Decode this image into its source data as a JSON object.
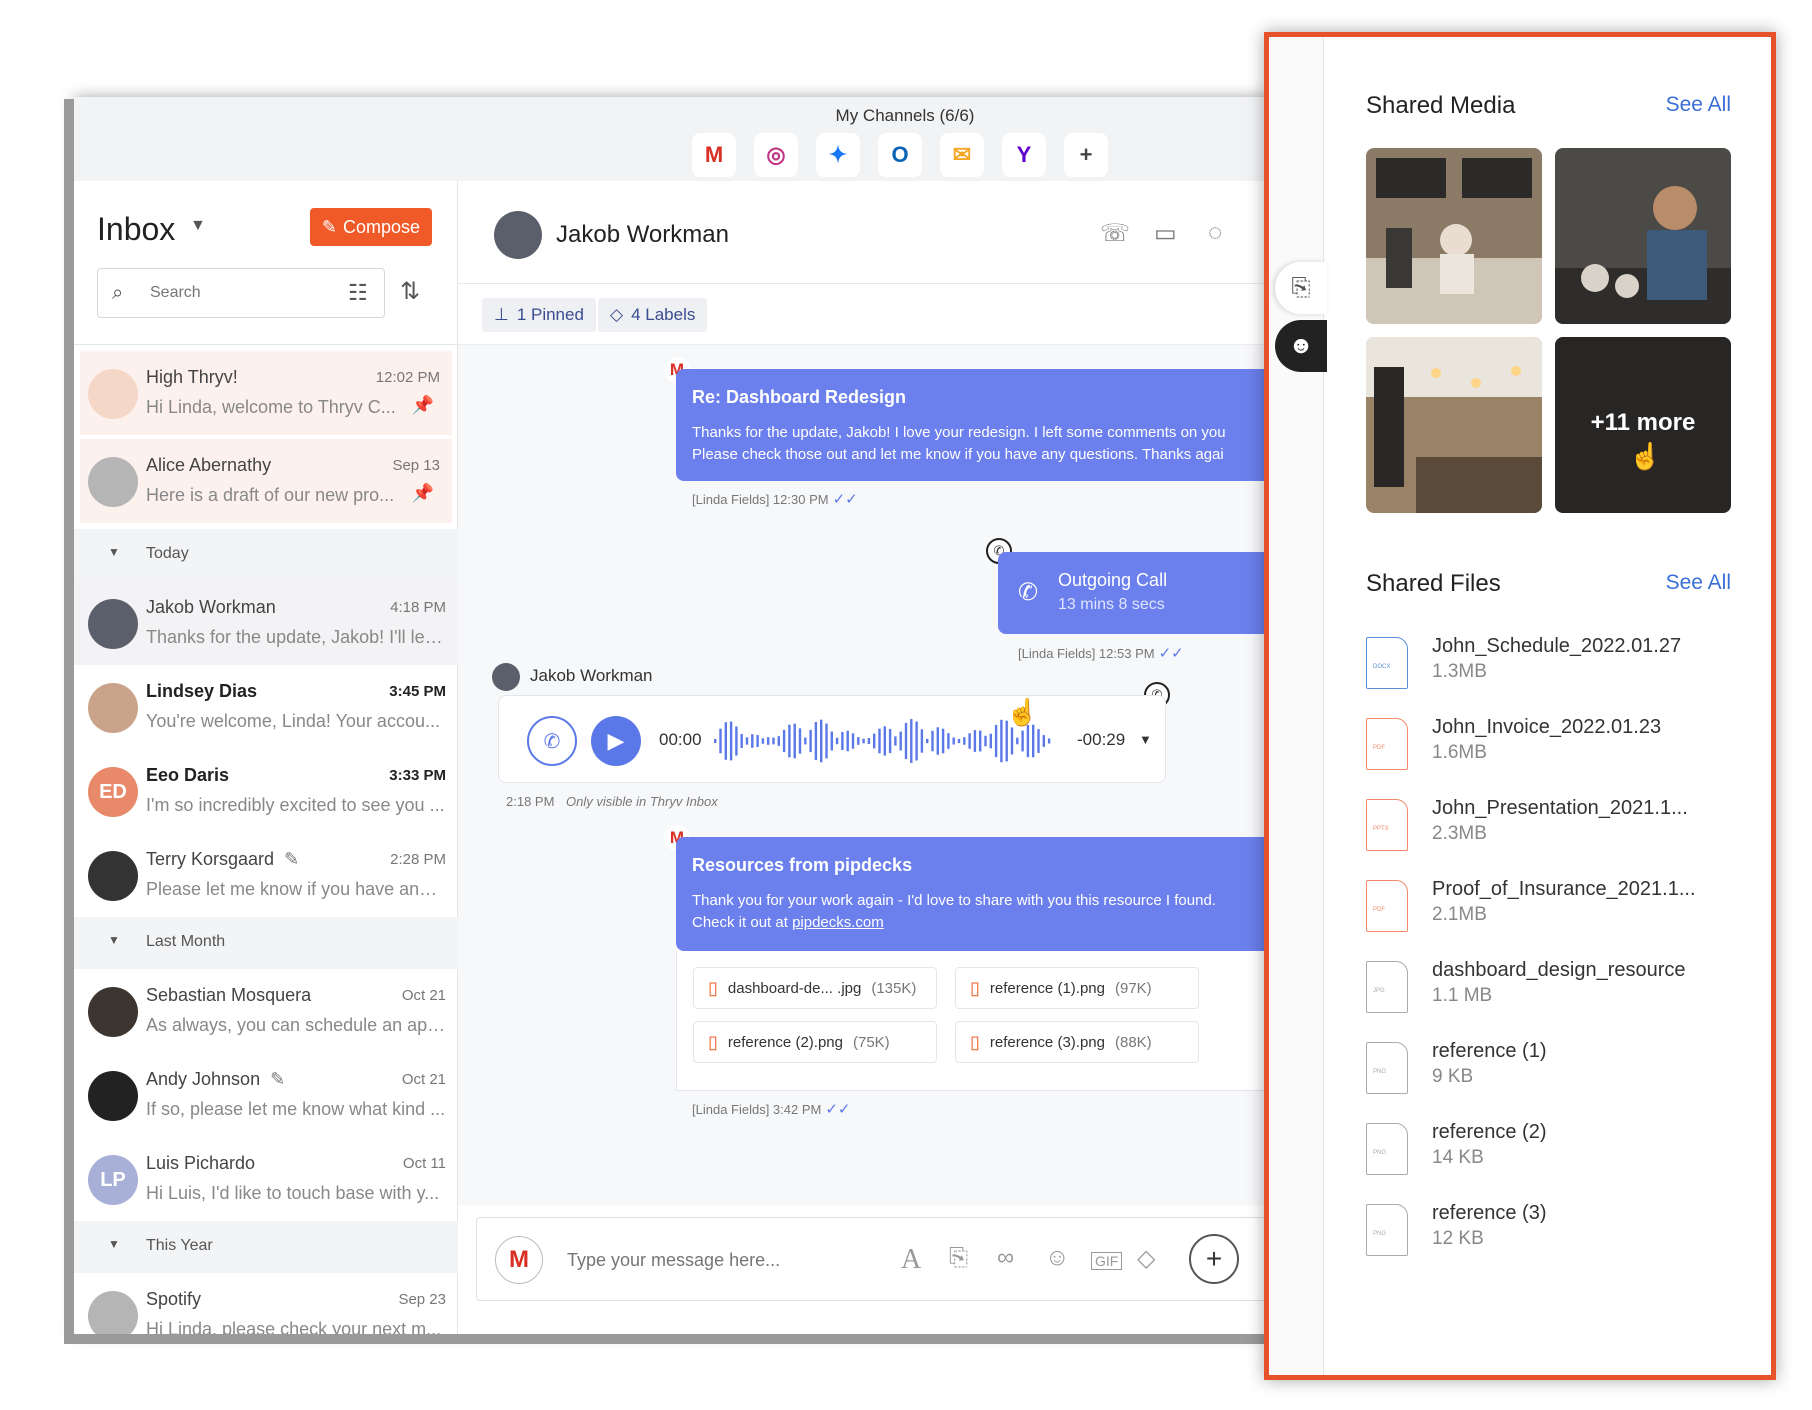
{
  "channels": {
    "title": "My Channels (6/6)",
    "icons": [
      {
        "name": "gmail-icon",
        "glyph": "M",
        "color": "#d93025"
      },
      {
        "name": "instagram-icon",
        "glyph": "◎",
        "color": "#c13584"
      },
      {
        "name": "messenger-icon",
        "glyph": "✦",
        "color": "#1877f2"
      },
      {
        "name": "outlook-icon",
        "glyph": "O",
        "color": "#0a64b5"
      },
      {
        "name": "email-icon",
        "glyph": "✉",
        "color": "#f5a623"
      },
      {
        "name": "yahoo-icon",
        "glyph": "Y",
        "color": "#5f01d1"
      },
      {
        "name": "add-channel-icon",
        "glyph": "+",
        "color": "#444444"
      }
    ]
  },
  "inbox": {
    "title": "Inbox",
    "compose_label": "Compose",
    "search_placeholder": "Search",
    "pinned": [
      {
        "name": "High Thryv!",
        "time": "12:02 PM",
        "preview": "Hi Linda, welcome to Thryv C...",
        "avatar_color": "#f5d7c8"
      },
      {
        "name": "Alice Abernathy",
        "time": "Sep 13",
        "preview": "Here is a draft of our new pro...",
        "avatar_color": "#b5b5b5"
      }
    ],
    "sections": [
      {
        "label": "Today",
        "items": [
          {
            "name": "Jakob Workman",
            "time": "4:18 PM",
            "preview": "Thanks for the update, Jakob! I'll let ...",
            "avatar_color": "#5a5f6b",
            "bold": false,
            "selected": true
          },
          {
            "name": "Lindsey Dias",
            "time": "3:45 PM",
            "preview": "You're welcome, Linda! Your accou...",
            "avatar_color": "#c9a48a",
            "bold": true
          },
          {
            "name": "Eeo Daris",
            "time": "3:33 PM",
            "preview": "I'm so incredibly excited to see you ...",
            "avatar_color": "#e8896a",
            "initials": "ED",
            "bold": true
          },
          {
            "name": "Terry Korsgaard",
            "time": "2:28 PM",
            "preview": "Please let me know if you have any ...",
            "avatar_color": "#333333",
            "edit": true
          }
        ]
      },
      {
        "label": "Last Month",
        "items": [
          {
            "name": "Sebastian Mosquera",
            "time": "Oct 21",
            "preview": "As always, you can schedule an app...",
            "avatar_color": "#3d3530"
          },
          {
            "name": "Andy Johnson",
            "time": "Oct 21",
            "preview": "If so, please let me know what kind ...",
            "avatar_color": "#222222",
            "edit": true
          },
          {
            "name": "Luis Pichardo",
            "time": "Oct 11",
            "preview": "Hi Luis, I'd like to touch base with y...",
            "avatar_color": "#a9b0d8",
            "initials": "LP"
          }
        ]
      },
      {
        "label": "This Year",
        "items": [
          {
            "name": "Spotify",
            "time": "Sep 23",
            "preview": "Hi Linda, please check your next m...",
            "avatar_color": "#b5b5b5"
          }
        ]
      }
    ]
  },
  "chat": {
    "contact_name": "Jakob Workman",
    "pinned_label": "1 Pinned",
    "labels_label": "4 Labels",
    "messages": {
      "email1_title": "Re: Dashboard Redesign",
      "email1_line1": "Thanks for the update, Jakob! I love your redesign. I left some comments on you",
      "email1_line2": "Please check those out and let me know if you have any questions. Thanks agai",
      "email1_meta": "[Linda Fields] 12:30 PM",
      "call_title": "Outgoing Call",
      "call_duration": "13 mins 8 secs",
      "call_meta": "[Linda Fields] 12:53 PM",
      "voice_sender": "Jakob Workman",
      "voice_start": "00:00",
      "voice_end": "-00:29",
      "voice_meta_time": "2:18 PM",
      "voice_meta_note": "Only visible in Thryv Inbox",
      "email2_title": "Resources from pipdecks",
      "email2_line1": "Thank you for your work again - I'd love to share with you this resource I found.",
      "email2_line2_prefix": "Check it out at ",
      "email2_link": "pipdecks.com",
      "email2_meta": "[Linda Fields] 3:42 PM",
      "attachments": [
        {
          "name": "dashboard-de... .jpg",
          "size": "(135K)"
        },
        {
          "name": "reference (1).png",
          "size": "(97K)"
        },
        {
          "name": "reference (2).png",
          "size": "(75K)"
        },
        {
          "name": "reference (3).png",
          "size": "(88K)"
        }
      ]
    },
    "composer_placeholder": "Type your message here..."
  },
  "side_panel": {
    "media_title": "Shared Media",
    "media_see_all": "See All",
    "more_label": "+11 more",
    "media_colors": [
      "#8a7a66",
      "#4c4a47",
      "#9a8266",
      "#3f3c3a"
    ],
    "files_title": "Shared Files",
    "files_see_all": "See All",
    "files": [
      {
        "name": "John_Schedule_2022.01.27",
        "size": "1.3MB",
        "type": "DOCX",
        "color": "#5b8fd8"
      },
      {
        "name": "John_Invoice_2022.01.23",
        "size": "1.6MB",
        "type": "PDF",
        "color": "#f08a6a"
      },
      {
        "name": "John_Presentation_2021.1...",
        "size": "2.3MB",
        "type": "PPTX",
        "color": "#f08a6a"
      },
      {
        "name": "Proof_of_Insurance_2021.1...",
        "size": "2.1MB",
        "type": "PDF",
        "color": "#f08a6a"
      },
      {
        "name": "dashboard_design_resource",
        "size": "1.1 MB",
        "type": "JPG",
        "color": "#aaaaaa"
      },
      {
        "name": "reference (1)",
        "size": "9 KB",
        "type": "PNG",
        "color": "#aaaaaa"
      },
      {
        "name": "reference (2)",
        "size": "14 KB",
        "type": "PNG",
        "color": "#aaaaaa"
      },
      {
        "name": "reference (3)",
        "size": "12 KB",
        "type": "PNG",
        "color": "#aaaaaa"
      }
    ]
  }
}
